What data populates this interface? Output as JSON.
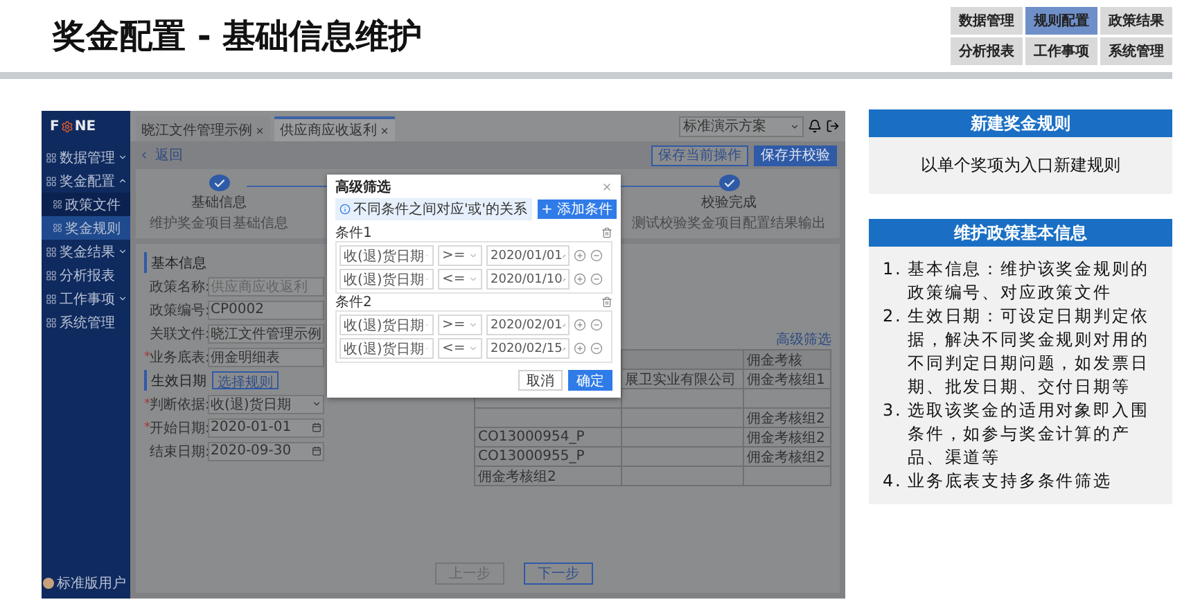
{
  "title": "奖金配置 - 基础信息维护",
  "nav": [
    {
      "label": "数据管理",
      "selected": false
    },
    {
      "label": "规则配置",
      "selected": true
    },
    {
      "label": "政策结果",
      "selected": false
    },
    {
      "label": "分析报表",
      "selected": false
    },
    {
      "label": "工作事项",
      "selected": false
    },
    {
      "label": "系统管理",
      "selected": false
    }
  ],
  "app": {
    "logo": [
      "F",
      "NE"
    ],
    "sidebar": [
      {
        "label": "数据管理",
        "expanded": false
      },
      {
        "label": "奖金配置",
        "expanded": true,
        "children": [
          {
            "label": "政策文件",
            "selected": false
          },
          {
            "label": "奖金规则",
            "selected": true
          }
        ]
      },
      {
        "label": "奖金结果",
        "expanded": false
      },
      {
        "label": "分析报表"
      },
      {
        "label": "工作事项",
        "expanded": false
      },
      {
        "label": "系统管理"
      }
    ],
    "user": "标准版用户",
    "tabs": [
      {
        "label": "晓江文件管理示例",
        "selected": false
      },
      {
        "label": "供应商应收返利",
        "selected": true
      }
    ],
    "scheme_select": "标准演示方案",
    "back": "返回",
    "actions": [
      {
        "label": "保存当前操作",
        "kind": "outline"
      },
      {
        "label": "保存并校验",
        "kind": "primary"
      }
    ],
    "steps": [
      {
        "title": "基础信息",
        "desc": "维护奖金项目基础信息",
        "done": true
      },
      {
        "title": "校验完成",
        "desc": "测试校验奖金项目配置结果输出",
        "done": true
      }
    ],
    "form": [
      {
        "kind": "heading",
        "label": "基本信息"
      },
      {
        "kind": "input",
        "label": "政策名称:",
        "placeholder": "供应商应收返利"
      },
      {
        "kind": "input",
        "label": "政策编号:",
        "value": "CP0002"
      },
      {
        "kind": "input",
        "label": "关联文件:",
        "value": "晓江文件管理示例"
      },
      {
        "kind": "input",
        "label": "业务底表:",
        "value": "佣金明细表",
        "required_mark": "*"
      },
      {
        "kind": "heading",
        "label": "生效日期",
        "button": "选择规则"
      },
      {
        "kind": "select",
        "label": "判断依据:",
        "value": "收(退)货日期",
        "required_mark": "*"
      },
      {
        "kind": "date",
        "label": "开始日期:",
        "value": "2020-01-01",
        "required_mark": "*"
      },
      {
        "kind": "date",
        "label": "结束日期:",
        "value": "2020-09-30"
      }
    ],
    "table": {
      "link": "高级筛选",
      "column_3": "佣金考核",
      "rows": [
        {
          "column_2": "展卫实业有限公司",
          "column_3": "佣金考核组1"
        },
        {},
        {
          "column_3": "佣金考核组2"
        },
        {
          "column_1": "CO13000954_P",
          "column_3": "佣金考核组2"
        },
        {
          "column_1": "CO13000955_P",
          "column_3": "佣金考核组2"
        },
        {
          "column_1": "佣金考核组2"
        }
      ]
    },
    "pager": [
      {
        "label": "上一步",
        "disabled": true
      },
      {
        "label": "下一步",
        "disabled": false
      }
    ],
    "modal": {
      "title": "高级筛选",
      "notice": "不同条件之间对应'或'的关系",
      "add_button": "+ 添加条件",
      "groups": [
        {
          "label": "条件1",
          "rows": [
            {
              "field": "收(退)货日期",
              "op": ">=",
              "date": "2020/01/01"
            },
            {
              "field": "收(退)货日期",
              "op": "<=",
              "date": "2020/01/10"
            }
          ]
        },
        {
          "label": "条件2",
          "rows": [
            {
              "field": "收(退)货日期",
              "op": ">=",
              "date": "2020/02/01"
            },
            {
              "field": "收(退)货日期",
              "op": "<=",
              "date": "2020/02/15"
            }
          ]
        }
      ],
      "buttons": [
        {
          "label": "取消",
          "kind": "default"
        },
        {
          "label": "确定",
          "kind": "primary"
        }
      ]
    }
  },
  "panels": [
    {
      "title": "新建奖金规则",
      "kind": "text",
      "text": "以单个奖项为入口新建规则"
    },
    {
      "title": "维护政策基本信息",
      "kind": "list",
      "items": [
        {
          "number": "1.",
          "text": "基本信息：维护该奖金规则的政策编号、对应政策文件"
        },
        {
          "number": "2.",
          "text": "生效日期：可设定日期判定依据，解决不同奖金规则对用的不同判定日期问题，如发票日期、批发日期、交付日期等"
        },
        {
          "number": "3.",
          "text": "选取该奖金的适用对象即入围条件，如参与奖金计算的产品、渠道等"
        },
        {
          "number": "4.",
          "text": "业务底表支持多条件筛选"
        }
      ]
    }
  ]
}
